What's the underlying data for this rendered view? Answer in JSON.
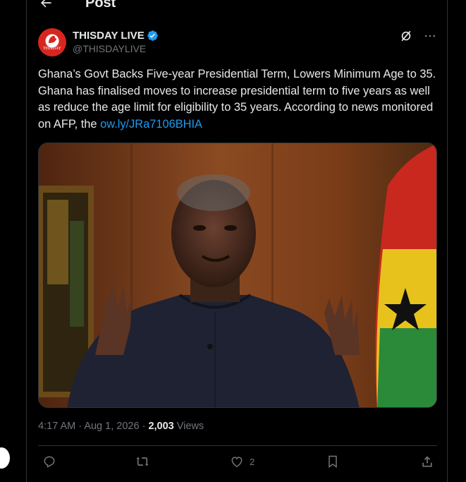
{
  "header": {
    "title": "Post",
    "back_icon": "arrow-left-icon"
  },
  "post": {
    "author": {
      "display_name": "THISDAY LIVE",
      "handle": "@THISDAYLIVE",
      "avatar_text": "THISDAY",
      "verified_icon": "verified-badge-icon",
      "verified_color": "#1d9bf0"
    },
    "header_actions": {
      "grok_icon": "grok-icon",
      "more_icon": "more-icon"
    },
    "text": "Ghana’s Govt Backs Five-year Presidential Term, Lowers Minimum Age to 35. Ghana has finalised moves to increase presidential term to five years as well as reduce the age limit for eligibility to 35 years. According to news monitored on AFP, the ",
    "link": "ow.ly/JRa7106BHIA",
    "image": {
      "description_icon": "photo"
    },
    "time": "4:17 AM",
    "separator": "·",
    "date": "Aug 1, 2026",
    "views_count": "2,003",
    "views_label": "Views",
    "actions": {
      "reply_icon": "reply-icon",
      "repost_icon": "repost-icon",
      "like_icon": "heart-icon",
      "like_count": "2",
      "bookmark_icon": "bookmark-icon",
      "share_icon": "share-icon"
    }
  },
  "colors": {
    "background": "#000000",
    "text": "#e7e9ea",
    "muted": "#71767b",
    "link": "#1d9bf0",
    "border": "#2f3336"
  }
}
